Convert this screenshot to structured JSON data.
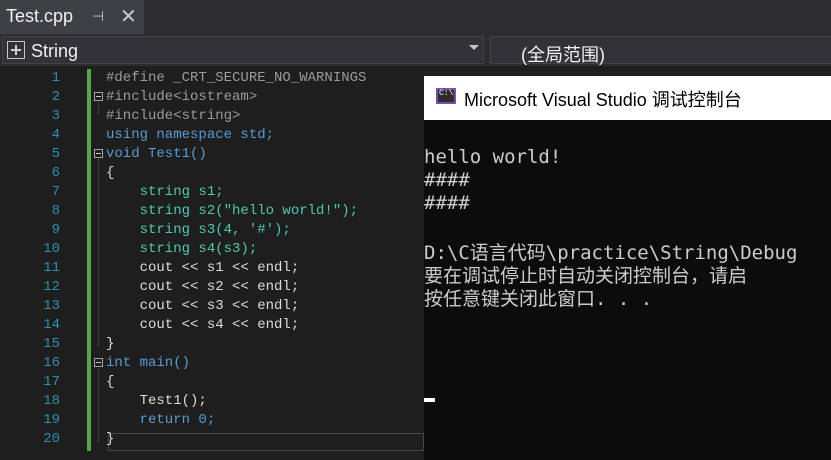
{
  "tab": {
    "title": "Test.cpp",
    "pin_icon": "pin-icon",
    "close_icon": "close-icon"
  },
  "navbar": {
    "scope": "String",
    "member": "(全局范围)",
    "scope_icon": "class-icon"
  },
  "editor": {
    "line_numbers": [
      "1",
      "2",
      "3",
      "4",
      "5",
      "6",
      "7",
      "8",
      "9",
      "10",
      "11",
      "12",
      "13",
      "14",
      "15",
      "16",
      "17",
      "18",
      "19",
      "20"
    ],
    "lines": [
      "#define _CRT_SECURE_NO_WARNINGS",
      "#include<iostream>",
      "#include<string>",
      "using namespace std;",
      "void Test1()",
      "{",
      "    string s1;",
      "    string s2(\"hello world!\");",
      "    string s3(4, '#');",
      "    string s4(s3);",
      "    cout << s1 << endl;",
      "    cout << s2 << endl;",
      "    cout << s3 << endl;",
      "    cout << s4 << endl;",
      "}",
      "int main()",
      "{",
      "    Test1();",
      "    return 0;",
      "}"
    ],
    "colors": {
      "keyword": "#569cd6",
      "type": "#4ec9b0",
      "preprocessor": "#9b9b9b",
      "string": "#d69d85",
      "line_number": "#2b91af",
      "changebar": "#57a64a"
    }
  },
  "console": {
    "title": "Microsoft Visual Studio 调试控制台",
    "icon": "console-app-icon",
    "output": [
      "hello world!",
      "####",
      "####",
      "",
      "D:\\C语言代码\\practice\\String\\Debug",
      "要在调试停止时自动关闭控制台，请启",
      "按任意键关闭此窗口. . ."
    ]
  }
}
